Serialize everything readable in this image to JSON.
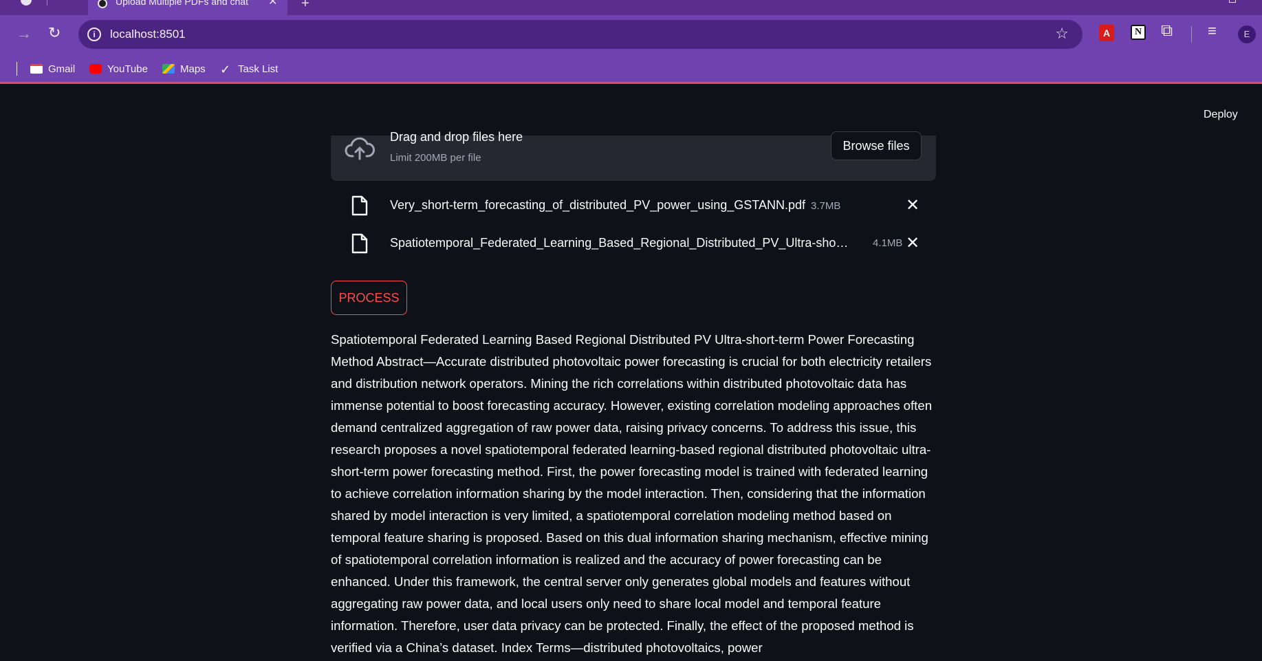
{
  "browser": {
    "tab_title": "Upload Multiple PDFs and chat",
    "url": "localhost:8501",
    "profile_initial": "E",
    "bookmarks": [
      "Gmail",
      "YouTube",
      "Maps",
      "Task List"
    ]
  },
  "app": {
    "deploy_label": "Deploy",
    "uploader": {
      "title": "Drag and drop files here",
      "limit": "Limit 200MB per file",
      "browse_label": "Browse files"
    },
    "files": [
      {
        "name": "Very_short-term_forecasting_of_distributed_PV_power_using_GSTANN.pdf",
        "size": "3.7MB"
      },
      {
        "name": "Spatiotemporal_Federated_Learning_Based_Regional_Distributed_PV_Ultra-sho…",
        "size": "4.1MB"
      }
    ],
    "process_label": "PROCESS",
    "output_text": "Spatiotemporal Federated Learning Based Regional Distributed PV Ultra-short-term Power Forecasting Method Abstract—Accurate distributed photovoltaic power forecasting is crucial for both electricity retailers and distribution network operators. Mining the rich correlations within distributed photovoltaic data has immense potential to boost forecasting accuracy. However, existing correlation modeling approaches often demand centralized aggregation of raw power data, raising privacy concerns. To address this issue, this research proposes a novel spatiotemporal federated learning-based regional distributed photovoltaic ultra-short-term power forecasting method. First, the power forecasting model is trained with federated learning to achieve correlation information sharing by the model interaction. Then, considering that the information shared by model interaction is very limited, a spatiotemporal correlation modeling method based on temporal feature sharing is proposed. Based on this dual information sharing mechanism, effective mining of spatiotemporal correlation information is realized and the accuracy of power forecasting can be enhanced. Under this framework, the central server only generates global models and features without aggregating raw power data, and local users only need to share local model and temporal feature information. Therefore, user data privacy can be protected. Finally, the effect of the proposed method is verified via a China’s dataset. Index Terms—distributed photovoltaics, power"
  }
}
